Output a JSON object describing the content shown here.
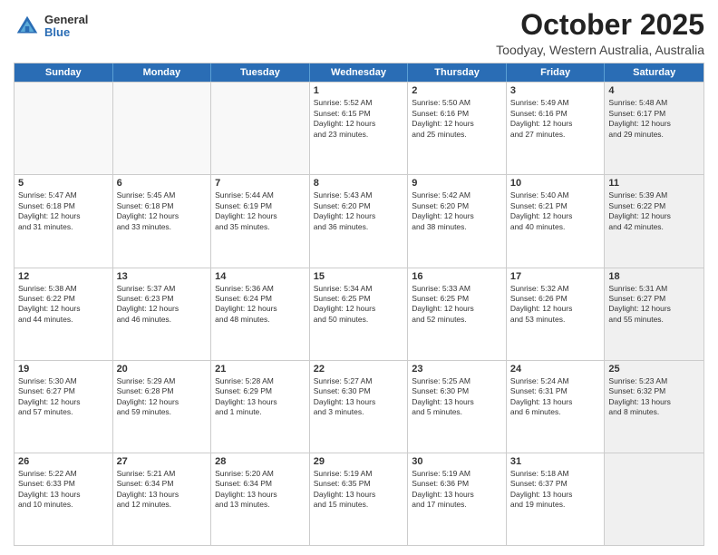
{
  "logo": {
    "general": "General",
    "blue": "Blue"
  },
  "title": "October 2025",
  "location": "Toodyay, Western Australia, Australia",
  "header_days": [
    "Sunday",
    "Monday",
    "Tuesday",
    "Wednesday",
    "Thursday",
    "Friday",
    "Saturday"
  ],
  "rows": [
    [
      {
        "day": "",
        "info": "",
        "empty": true
      },
      {
        "day": "",
        "info": "",
        "empty": true
      },
      {
        "day": "",
        "info": "",
        "empty": true
      },
      {
        "day": "1",
        "info": "Sunrise: 5:52 AM\nSunset: 6:15 PM\nDaylight: 12 hours\nand 23 minutes."
      },
      {
        "day": "2",
        "info": "Sunrise: 5:50 AM\nSunset: 6:16 PM\nDaylight: 12 hours\nand 25 minutes."
      },
      {
        "day": "3",
        "info": "Sunrise: 5:49 AM\nSunset: 6:16 PM\nDaylight: 12 hours\nand 27 minutes."
      },
      {
        "day": "4",
        "info": "Sunrise: 5:48 AM\nSunset: 6:17 PM\nDaylight: 12 hours\nand 29 minutes.",
        "shaded": true
      }
    ],
    [
      {
        "day": "5",
        "info": "Sunrise: 5:47 AM\nSunset: 6:18 PM\nDaylight: 12 hours\nand 31 minutes."
      },
      {
        "day": "6",
        "info": "Sunrise: 5:45 AM\nSunset: 6:18 PM\nDaylight: 12 hours\nand 33 minutes."
      },
      {
        "day": "7",
        "info": "Sunrise: 5:44 AM\nSunset: 6:19 PM\nDaylight: 12 hours\nand 35 minutes."
      },
      {
        "day": "8",
        "info": "Sunrise: 5:43 AM\nSunset: 6:20 PM\nDaylight: 12 hours\nand 36 minutes."
      },
      {
        "day": "9",
        "info": "Sunrise: 5:42 AM\nSunset: 6:20 PM\nDaylight: 12 hours\nand 38 minutes."
      },
      {
        "day": "10",
        "info": "Sunrise: 5:40 AM\nSunset: 6:21 PM\nDaylight: 12 hours\nand 40 minutes."
      },
      {
        "day": "11",
        "info": "Sunrise: 5:39 AM\nSunset: 6:22 PM\nDaylight: 12 hours\nand 42 minutes.",
        "shaded": true
      }
    ],
    [
      {
        "day": "12",
        "info": "Sunrise: 5:38 AM\nSunset: 6:22 PM\nDaylight: 12 hours\nand 44 minutes."
      },
      {
        "day": "13",
        "info": "Sunrise: 5:37 AM\nSunset: 6:23 PM\nDaylight: 12 hours\nand 46 minutes."
      },
      {
        "day": "14",
        "info": "Sunrise: 5:36 AM\nSunset: 6:24 PM\nDaylight: 12 hours\nand 48 minutes."
      },
      {
        "day": "15",
        "info": "Sunrise: 5:34 AM\nSunset: 6:25 PM\nDaylight: 12 hours\nand 50 minutes."
      },
      {
        "day": "16",
        "info": "Sunrise: 5:33 AM\nSunset: 6:25 PM\nDaylight: 12 hours\nand 52 minutes."
      },
      {
        "day": "17",
        "info": "Sunrise: 5:32 AM\nSunset: 6:26 PM\nDaylight: 12 hours\nand 53 minutes."
      },
      {
        "day": "18",
        "info": "Sunrise: 5:31 AM\nSunset: 6:27 PM\nDaylight: 12 hours\nand 55 minutes.",
        "shaded": true
      }
    ],
    [
      {
        "day": "19",
        "info": "Sunrise: 5:30 AM\nSunset: 6:27 PM\nDaylight: 12 hours\nand 57 minutes."
      },
      {
        "day": "20",
        "info": "Sunrise: 5:29 AM\nSunset: 6:28 PM\nDaylight: 12 hours\nand 59 minutes."
      },
      {
        "day": "21",
        "info": "Sunrise: 5:28 AM\nSunset: 6:29 PM\nDaylight: 13 hours\nand 1 minute."
      },
      {
        "day": "22",
        "info": "Sunrise: 5:27 AM\nSunset: 6:30 PM\nDaylight: 13 hours\nand 3 minutes."
      },
      {
        "day": "23",
        "info": "Sunrise: 5:25 AM\nSunset: 6:30 PM\nDaylight: 13 hours\nand 5 minutes."
      },
      {
        "day": "24",
        "info": "Sunrise: 5:24 AM\nSunset: 6:31 PM\nDaylight: 13 hours\nand 6 minutes."
      },
      {
        "day": "25",
        "info": "Sunrise: 5:23 AM\nSunset: 6:32 PM\nDaylight: 13 hours\nand 8 minutes.",
        "shaded": true
      }
    ],
    [
      {
        "day": "26",
        "info": "Sunrise: 5:22 AM\nSunset: 6:33 PM\nDaylight: 13 hours\nand 10 minutes."
      },
      {
        "day": "27",
        "info": "Sunrise: 5:21 AM\nSunset: 6:34 PM\nDaylight: 13 hours\nand 12 minutes."
      },
      {
        "day": "28",
        "info": "Sunrise: 5:20 AM\nSunset: 6:34 PM\nDaylight: 13 hours\nand 13 minutes."
      },
      {
        "day": "29",
        "info": "Sunrise: 5:19 AM\nSunset: 6:35 PM\nDaylight: 13 hours\nand 15 minutes."
      },
      {
        "day": "30",
        "info": "Sunrise: 5:19 AM\nSunset: 6:36 PM\nDaylight: 13 hours\nand 17 minutes."
      },
      {
        "day": "31",
        "info": "Sunrise: 5:18 AM\nSunset: 6:37 PM\nDaylight: 13 hours\nand 19 minutes."
      },
      {
        "day": "",
        "info": "",
        "empty": true,
        "shaded": true
      }
    ]
  ]
}
